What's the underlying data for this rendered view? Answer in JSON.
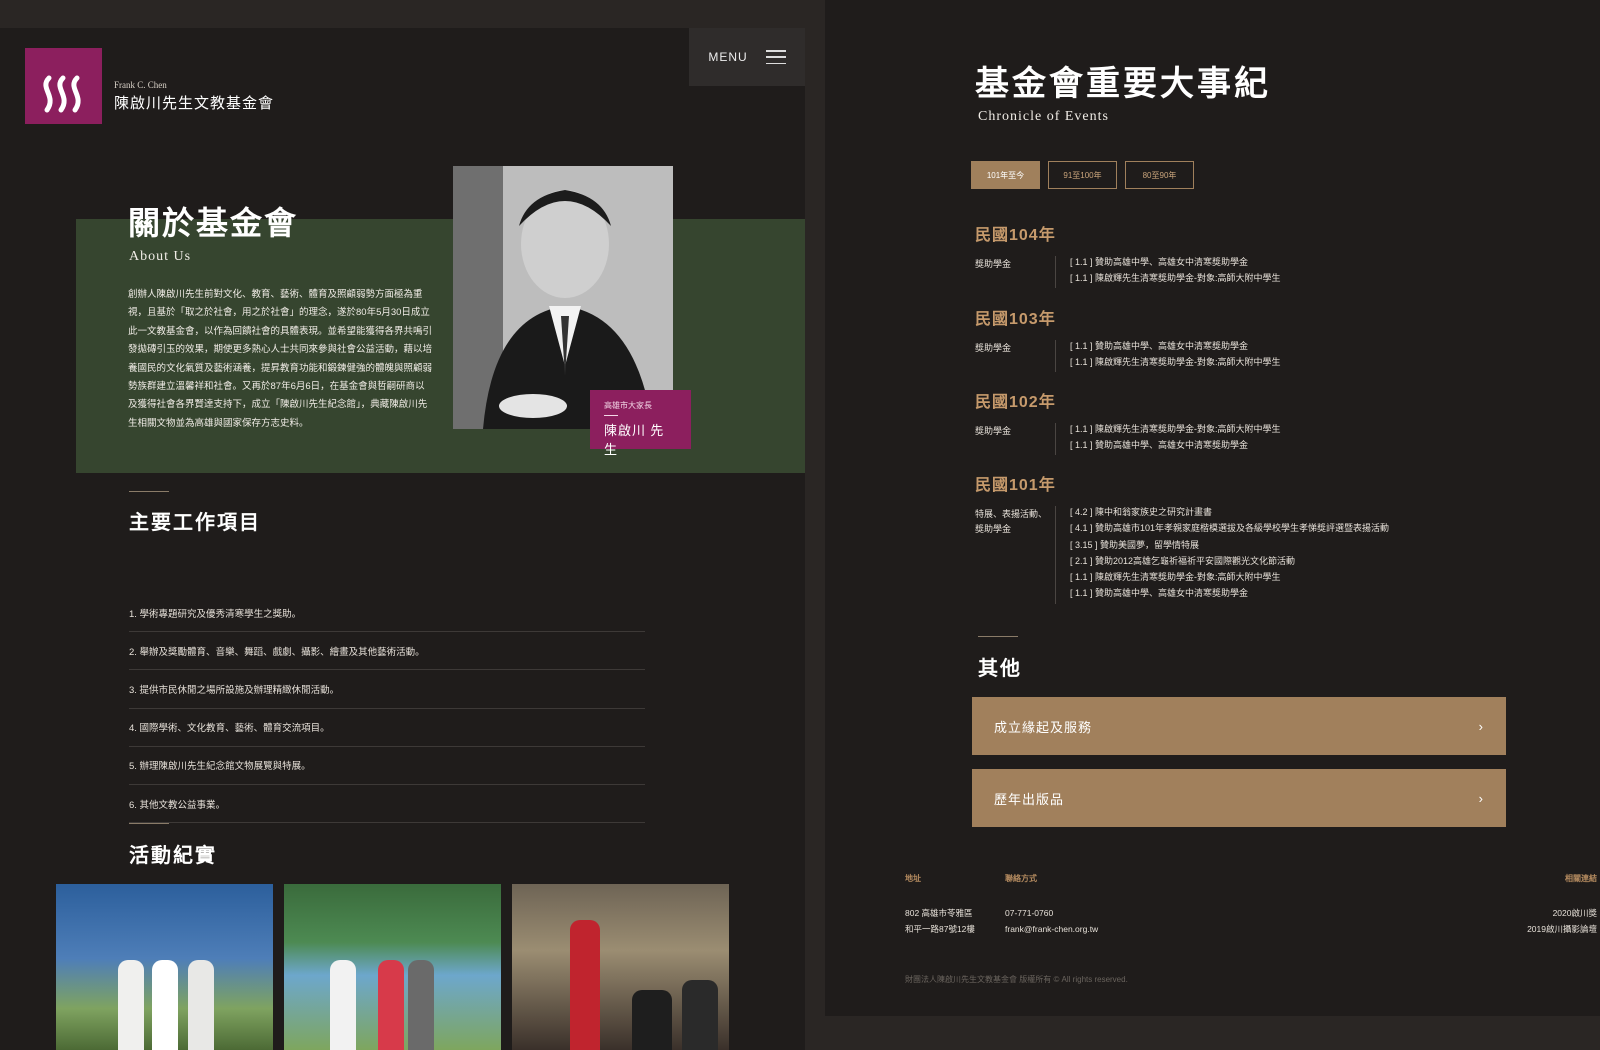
{
  "header": {
    "logo_en": "Frank C. Chen",
    "logo_zh": "陳啟川先生文教基金會",
    "menu_label": "MENU"
  },
  "about": {
    "title": "關於基金會",
    "subtitle": "About Us",
    "body": "創辦人陳啟川先生前對文化、教育、藝術、體育及照顧弱勢方面極為重視，且基於「取之於社會，用之於社會」的理念，遂於80年5月30日成立此一文教基金會，以作為回饋社會的具體表現。並希望能獲得各界共鳴引發拋磚引玉的效果，期使更多熱心人士共同來參與社會公益活動，藉以培養國民的文化氣質及藝術涵養，提昇教育功能和鍛鍊健強的體魄與照顧弱勢族群建立溫馨祥和社會。又再於87年6月6日，在基金會與哲嗣研商以及獲得社會各界賢達支持下，成立「陳啟川先生紀念館」，典藏陳啟川先生相關文物並為高雄與國家保存方志史料。",
    "caption_small": "高雄市大家長",
    "caption_name": "陳啟川 先生"
  },
  "work": {
    "title": "主要工作項目",
    "items": [
      "1. 學術專題研究及優秀清寒學生之獎助。",
      "2. 舉辦及獎勵體育、音樂、舞蹈、戲劇、攝影、繪畫及其他藝術活動。",
      "3. 提供市民休閒之場所設施及辦理精緻休閒活動。",
      "4. 國際學術、文化教育、藝術、體育交流項目。",
      "5. 辦理陳啟川先生紀念館文物展覽與特展。",
      "6. 其他文教公益事業。"
    ]
  },
  "activities": {
    "title": "活動紀實"
  },
  "chronicle": {
    "title": "基金會重要大事紀",
    "subtitle": "Chronicle of Events",
    "tabs": [
      "101年至今",
      "91至100年",
      "80至90年"
    ],
    "years": [
      {
        "year": "民國104年",
        "category": "獎助學金",
        "items": [
          "[ 1.1 ]  贊助高雄中學、高雄女中清寒獎助學金",
          "[ 1.1 ]  陳啟輝先生清寒獎助學金-對象:高師大附中學生"
        ]
      },
      {
        "year": "民國103年",
        "category": "獎助學金",
        "items": [
          "[ 1.1 ]  贊助高雄中學、高雄女中清寒獎助學金",
          "[ 1.1 ]  陳啟輝先生清寒獎助學金-對象:高師大附中學生"
        ]
      },
      {
        "year": "民國102年",
        "category": "獎助學金",
        "items": [
          "[ 1.1 ]  陳啟輝先生清寒獎助學金-對象:高師大附中學生",
          "[ 1.1 ]  贊助高雄中學、高雄女中清寒獎助學金"
        ]
      },
      {
        "year": "民國101年",
        "category": "特展、表揚活動、獎助學金",
        "items": [
          "[ 4.2 ]  陳中和翁家族史之研究計畫書",
          "[ 4.1 ]  贊助高雄市101年孝親家庭楷模選拔及各級學校學生孝悌獎評選暨表揚活動",
          "[ 3.15 ] 贊助美國夢，留學情特展",
          "[ 2.1 ]  贊助2012高雄乞龜祈福祈平安國際觀光文化節活動",
          "[ 1.1 ]  陳啟輝先生清寒獎助學金-對象:高師大附中學生",
          "[ 1.1 ]  贊助高雄中學、高雄女中清寒獎助學金"
        ]
      }
    ]
  },
  "other": {
    "title": "其他",
    "buttons": [
      "成立緣起及服務",
      "歷年出版品"
    ]
  },
  "footer": {
    "address_label": "地址",
    "address_line1": "802 高雄市苓雅區",
    "address_line2": "和平一路87號12樓",
    "contact_label": "聯絡方式",
    "phone": "07-771-0760",
    "email": "frank@frank-chen.org.tw",
    "links_label": "相關連結",
    "link1": "2020啟川獎",
    "link2": "2019啟川攝影論壇",
    "copyright": "財團法人陳啟川先生文教基金會  版權所有 © All rights reserved."
  }
}
